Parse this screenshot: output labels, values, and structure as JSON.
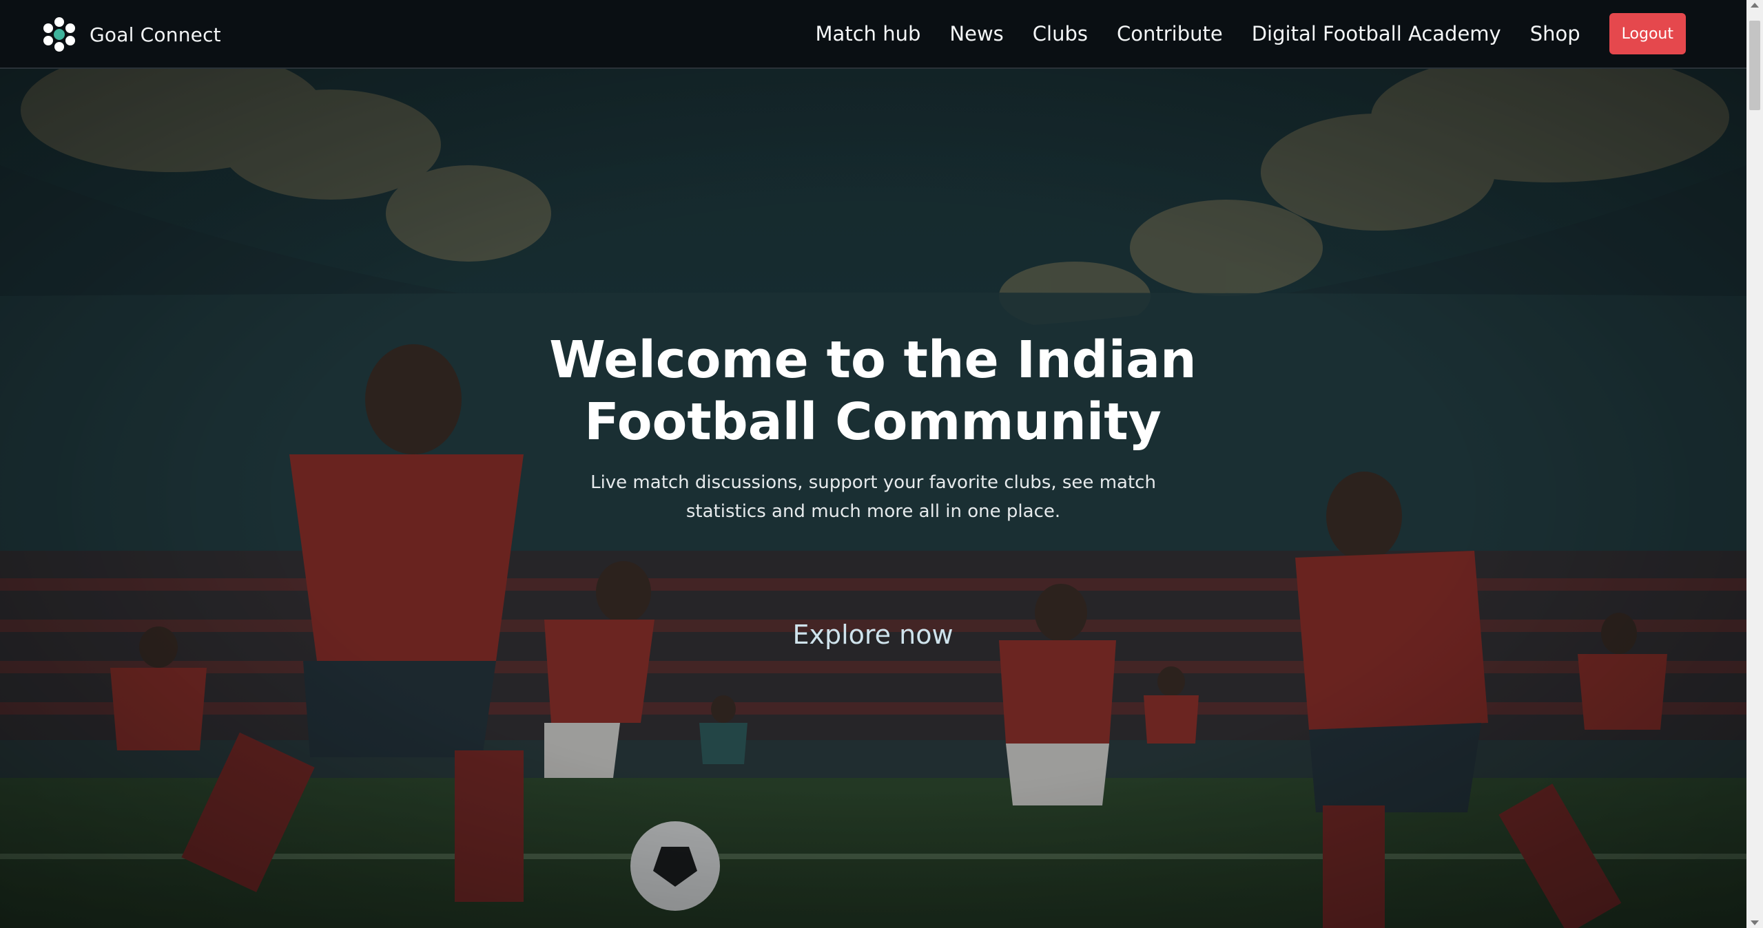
{
  "header": {
    "brand_name": "Goal Connect",
    "logo_icon": "soccer-ball-icon",
    "nav_items": [
      {
        "label": "Match hub"
      },
      {
        "label": "News"
      },
      {
        "label": "Clubs"
      },
      {
        "label": "Contribute"
      },
      {
        "label": "Digital Football Academy"
      },
      {
        "label": "Shop"
      }
    ],
    "logout_label": "Logout"
  },
  "hero": {
    "title": "Welcome to the Indian Football Community",
    "subtitle": "Live match discussions, support your favorite clubs, see match statistics and much more all in one place.",
    "cta_label": "Explore now"
  },
  "colors": {
    "navbar_bg": "#0a0f13",
    "logout_bg": "#e5484d",
    "logo_accent": "#3fb39c",
    "player_kit": "#b8322c"
  }
}
